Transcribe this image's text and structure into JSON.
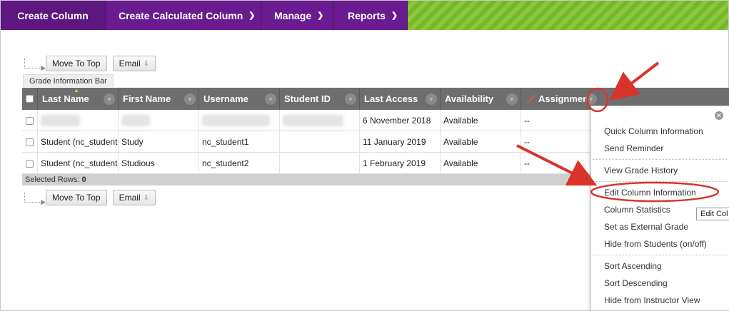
{
  "nav": {
    "create_column": "Create Column",
    "create_calculated": "Create Calculated Column",
    "manage": "Manage",
    "reports": "Reports",
    "chevron": "chevron-down-icon"
  },
  "actions": {
    "move_to_top": "Move To Top",
    "email": "Email"
  },
  "grade_info_bar": "Grade Information Bar",
  "grid": {
    "headers": [
      "Last Name",
      "First Name",
      "Username",
      "Student ID",
      "Last Access",
      "Availability",
      "Assignment"
    ],
    "rows": [
      {
        "last": "",
        "first": "",
        "username": "",
        "student_id": "",
        "last_access": "6 November 2018",
        "availability": "Available",
        "grade": "--"
      },
      {
        "last": "Student (nc_student",
        "first": "Study",
        "username": "nc_student1",
        "student_id": "",
        "last_access": "11 January 2019",
        "availability": "Available",
        "grade": "--"
      },
      {
        "last": "Student (nc_student",
        "first": "Studious",
        "username": "nc_student2",
        "student_id": "",
        "last_access": "1 February 2019",
        "availability": "Available",
        "grade": "--"
      }
    ],
    "selected_label": "Selected Rows:",
    "selected_count": "0"
  },
  "menu": {
    "items": [
      "Quick Column Information",
      "Send Reminder",
      "View Grade History",
      "Edit Column Information",
      "Column Statistics",
      "Set as External Grade",
      "Hide from Students (on/off)",
      "Sort Ascending",
      "Sort Descending",
      "Hide from Instructor View"
    ],
    "tooltip": "Edit Col"
  },
  "colors": {
    "nav_purple": "#6a1b8f",
    "nav_green": "#8cc63f",
    "header_gray": "#6e6e6e",
    "annotation_red": "#d9342b"
  }
}
